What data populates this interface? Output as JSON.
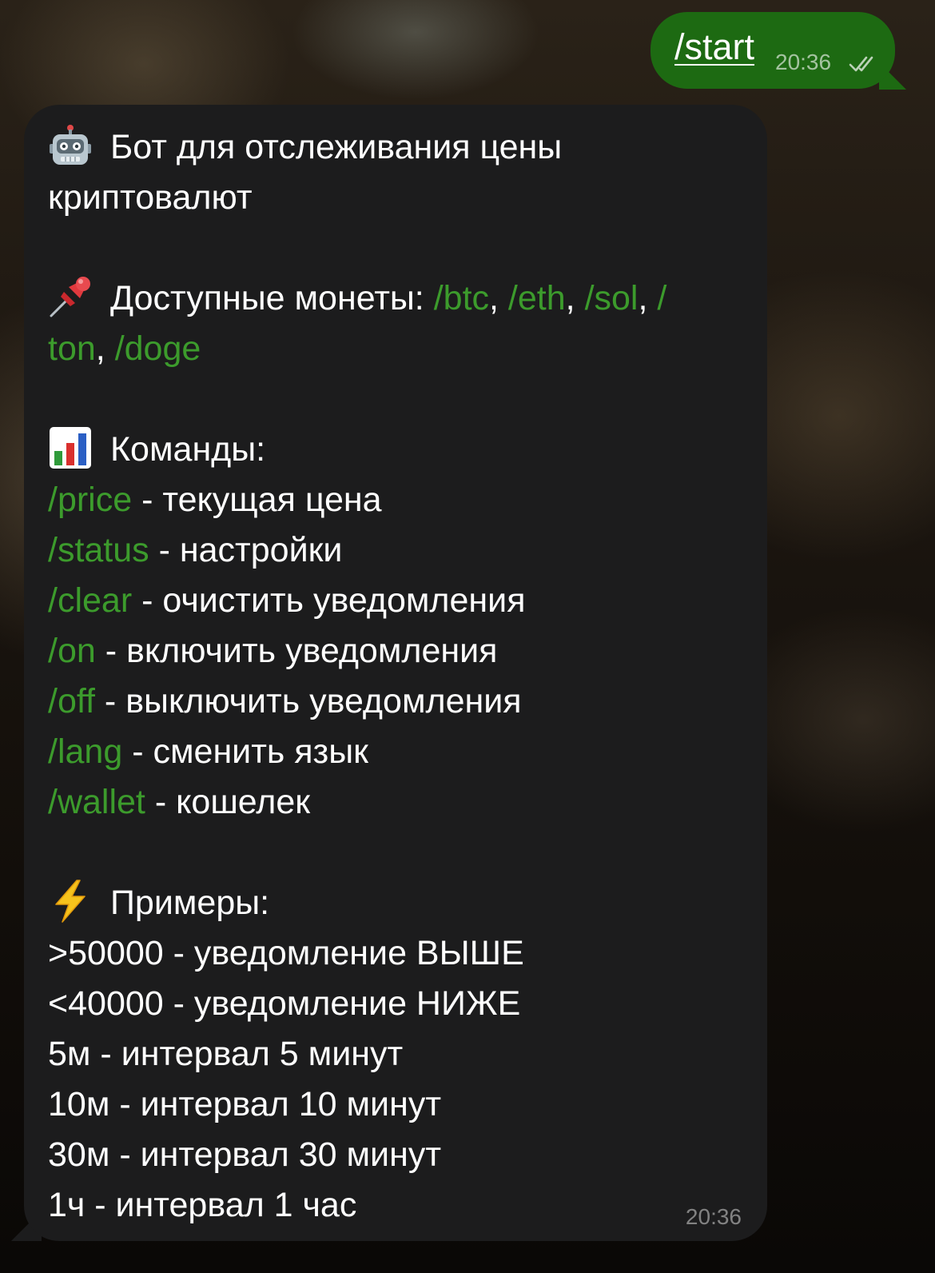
{
  "outgoing_message": {
    "text": "/start",
    "time": "20:36"
  },
  "incoming_message": {
    "time": "20:36",
    "title_line1": "Бот для отслеживания цены",
    "title_line2": "криптовалют",
    "coins_label": "Доступные монеты: ",
    "coins": [
      "/btc",
      "/eth",
      "/sol",
      "/",
      "ton",
      "/doge"
    ],
    "separator": ", ",
    "commands_label": "Команды:",
    "commands": [
      {
        "cmd": "/price",
        "desc": " - текущая цена"
      },
      {
        "cmd": "/status",
        "desc": " - настройки"
      },
      {
        "cmd": "/clear",
        "desc": " - очистить уведомления"
      },
      {
        "cmd": "/on",
        "desc": " - включить уведомления"
      },
      {
        "cmd": "/off",
        "desc": " - выключить уведомления"
      },
      {
        "cmd": "/lang",
        "desc": " - сменить язык"
      },
      {
        "cmd": "/wallet",
        "desc": " - кошелек"
      }
    ],
    "examples_label": "Примеры:",
    "examples": [
      ">50000 - уведомление ВЫШЕ",
      "<40000 - уведомление НИЖЕ",
      "5м - интервал 5 минут",
      "10м - интервал 10 минут",
      "30м - интервал 30 минут",
      "1ч - интервал 1 час"
    ],
    "icons": [
      "robot-icon",
      "pushpin-icon",
      "bar-chart-icon",
      "lightning-icon"
    ]
  },
  "colors": {
    "outgoing_bubble": "#1d6a12",
    "incoming_bubble": "#1c1c1d",
    "command_link": "#3c9b2c"
  }
}
